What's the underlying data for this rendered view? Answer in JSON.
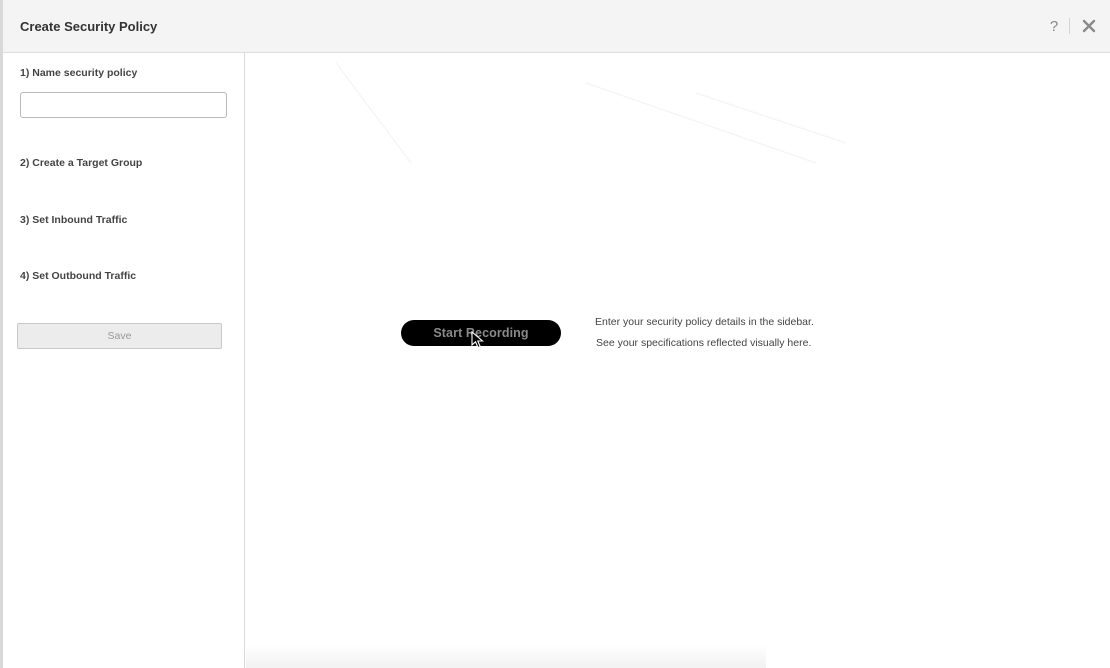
{
  "dialog": {
    "title": "Create Security Policy",
    "help_symbol": "?",
    "close_icon": "close-icon"
  },
  "sidebar": {
    "steps": [
      {
        "label": "1) Name security policy"
      },
      {
        "label": "2) Create a Target Group"
      },
      {
        "label": "3) Set Inbound Traffic"
      },
      {
        "label": "4) Set Outbound Traffic"
      }
    ],
    "name_input": {
      "value": "",
      "placeholder": ""
    },
    "save_label": "Save"
  },
  "canvas": {
    "record_label": "Start Recording",
    "hint_line_1": "Enter your security policy details in the sidebar.",
    "hint_line_2": "See your specifications reflected visually here."
  },
  "colors": {
    "header_bg": "#f4f4f4",
    "record_button_bg": "#000000",
    "record_button_text": "#8a8a8a",
    "save_button_bg": "#ececec"
  }
}
